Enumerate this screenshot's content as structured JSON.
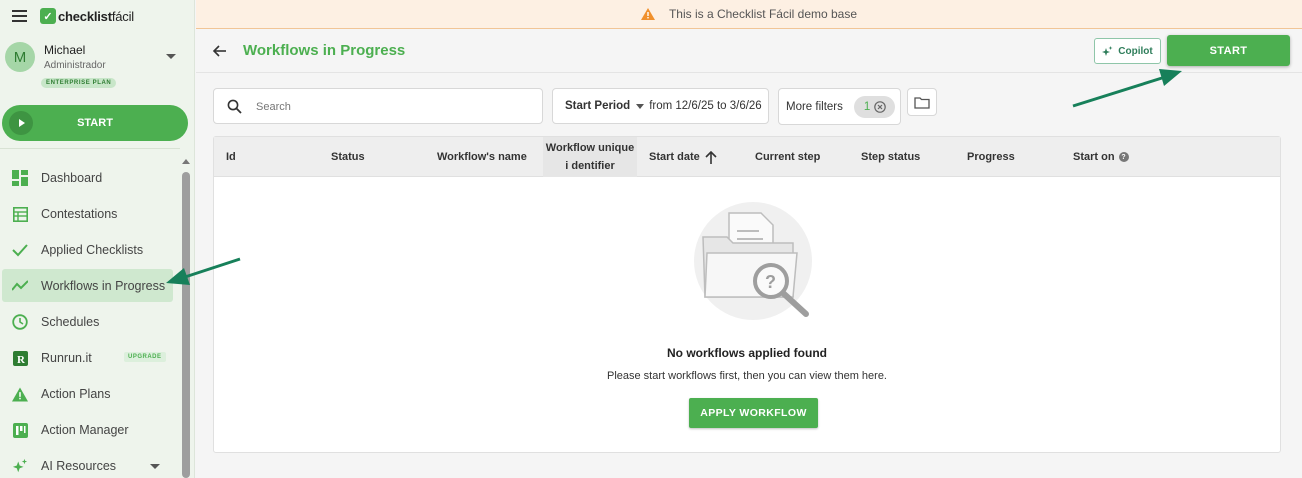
{
  "app": {
    "brand": "checklist",
    "brand_thin": "fácil",
    "colors": {
      "accent": "#4caf50",
      "sidebar_bg": "#eef4ec",
      "banner_bg": "#fdf0e3",
      "warning": "#f0902c",
      "annotation": "#17805a"
    }
  },
  "user": {
    "initial": "M",
    "name": "Michael",
    "role": "Administrador",
    "plan": "ENTERPRISE PLAN"
  },
  "sidebar": {
    "start_label": "START",
    "items": [
      {
        "label": "Dashboard",
        "icon": "dashboard-icon"
      },
      {
        "label": "Contestations",
        "icon": "table-icon"
      },
      {
        "label": "Applied Checklists",
        "icon": "check-icon"
      },
      {
        "label": "Workflows in Progress",
        "icon": "trend-icon",
        "active": true
      },
      {
        "label": "Schedules",
        "icon": "clock-icon"
      },
      {
        "label": "Runrun.it",
        "icon": "runrun-icon",
        "badge": "UPGRADE"
      },
      {
        "label": "Action Plans",
        "icon": "warning-icon"
      },
      {
        "label": "Action Manager",
        "icon": "kanban-icon"
      },
      {
        "label": "AI Resources",
        "icon": "sparkle-icon",
        "expandable": true
      }
    ]
  },
  "banner": {
    "text": "This is a Checklist Fácil demo base",
    "icon": "warning-icon"
  },
  "header": {
    "title": "Workflows in Progress",
    "copilot_label": "Copilot",
    "start_label": "START"
  },
  "filters": {
    "search_placeholder": "Search",
    "search_value": "",
    "period_label": "Start Period",
    "period_range": "from 12/6/25 to 3/6/26",
    "more_filters_label": "More filters",
    "more_filters_count": "1"
  },
  "table": {
    "columns": [
      "Id",
      "Status",
      "Workflow's name",
      "Workflow unique i dentifier",
      "Start date",
      "Current step",
      "Step status",
      "Progress",
      "Start on"
    ],
    "sorted_column": "Start date",
    "sort_direction": "ascending",
    "rows": [],
    "empty": {
      "title": "No workflows applied found",
      "subtitle": "Please start workflows first, then you can view them here.",
      "button": "APPLY WORKFLOW"
    }
  }
}
